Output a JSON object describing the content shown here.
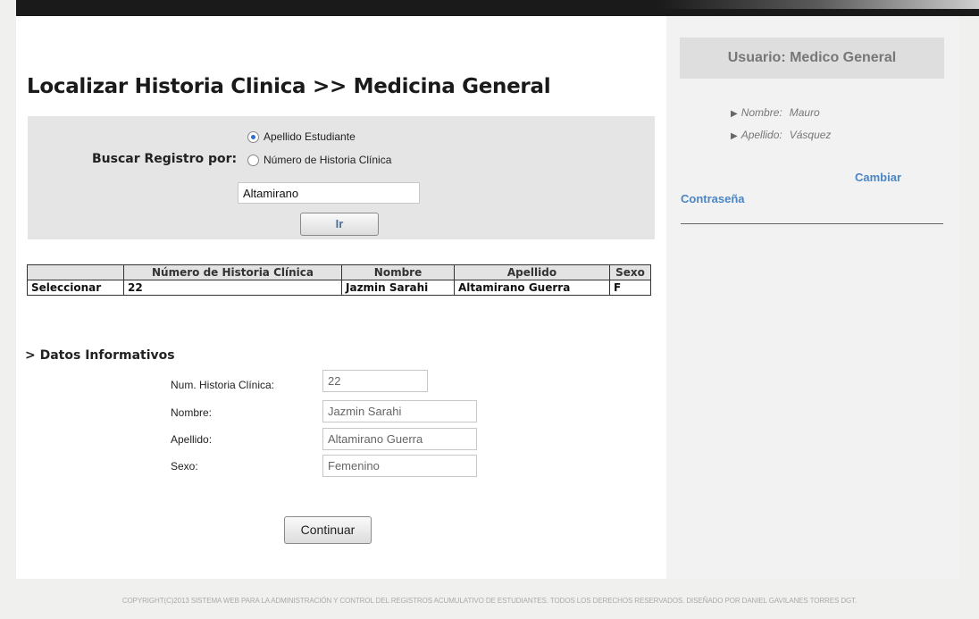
{
  "page_title": "Localizar Historia Clinica >> Medicina General",
  "search": {
    "label": "Buscar Registro por:",
    "options": [
      "Apellido Estudiante",
      "Número de Historia Clínica"
    ],
    "selected": 0,
    "value": "Altamirano",
    "button": "Ir"
  },
  "results": {
    "headers": [
      "",
      "Número de Historia Clínica",
      "Nombre",
      "Apellido",
      "Sexo"
    ],
    "rows": [
      [
        "Seleccionar",
        "22",
        "Jazmin Sarahi",
        "Altamirano Guerra",
        "F"
      ]
    ]
  },
  "info": {
    "title": "> Datos Informativos",
    "fields": [
      {
        "label": "Num. Historia Clínica:",
        "value": "22"
      },
      {
        "label": "Nombre:",
        "value": "Jazmin Sarahi"
      },
      {
        "label": "Apellido:",
        "value": "Altamirano Guerra"
      },
      {
        "label": "Sexo:",
        "value": "Femenino"
      }
    ],
    "button": "Continuar"
  },
  "sidebar": {
    "header": "Usuario:  Medico General",
    "nombre_label": "Nombre:",
    "nombre_value": "Mauro",
    "apellido_label": "Apellido:",
    "apellido_value": "Vásquez",
    "change_password_line1": "Cambiar",
    "change_password_line2": "Contraseña"
  },
  "footer": "COPYRIGHT(C)2013 SISTEMA WEB PARA LA ADMINISTRACIÓN Y CONTROL DEL REGISTROS ACUMULATIVO DE ESTUDIANTES. TODOS LOS DERECHOS RESERVADOS. DISEÑADO POR DANIEL GAVILANES TORRES DGT."
}
